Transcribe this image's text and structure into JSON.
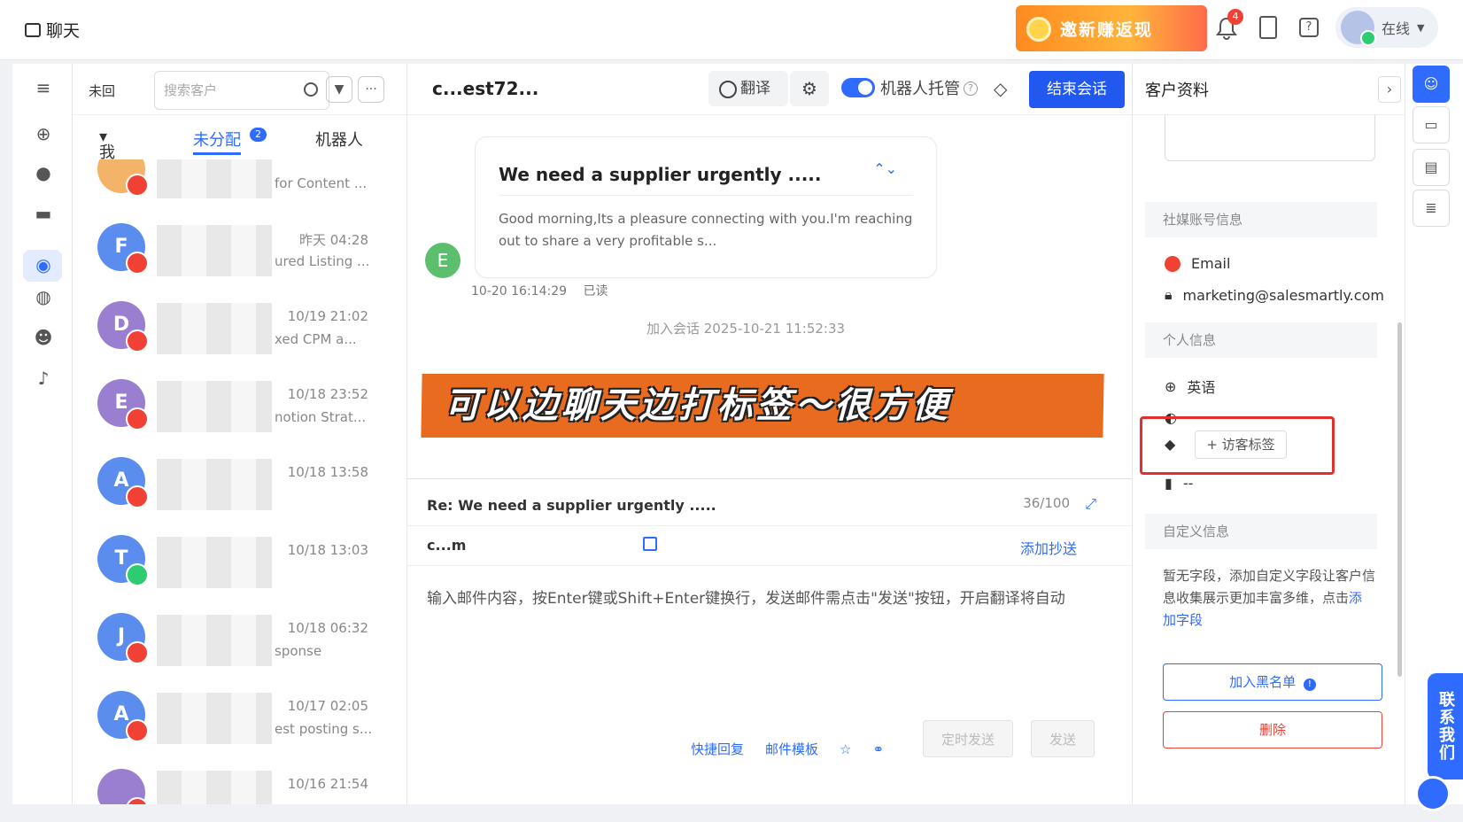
{
  "topbar": {
    "app_title": "聊天",
    "promo_text": "邀新赚返现",
    "notification_count": "4",
    "status_label": "在线"
  },
  "conv_list": {
    "unread_label": "未回",
    "search_placeholder": "搜索客户",
    "tabs": [
      {
        "label": "我"
      },
      {
        "label": "未分配",
        "badge": "2"
      },
      {
        "label": "机器人"
      }
    ],
    "items": [
      {
        "initial": "",
        "time": "",
        "snippet": "for Content ...",
        "color": "#f3b46a",
        "channel": "email"
      },
      {
        "initial": "F",
        "time": "昨天 04:28",
        "snippet": "ured Listing ...",
        "color": "#5b8def",
        "channel": "email"
      },
      {
        "initial": "D",
        "time": "10/19 21:02",
        "snippet": "xed CPM a...",
        "color": "#9a7fd1",
        "channel": "email"
      },
      {
        "initial": "E",
        "time": "10/18 23:52",
        "snippet": "notion Strat...",
        "color": "#9a7fd1",
        "channel": "email"
      },
      {
        "initial": "A",
        "time": "10/18 13:58",
        "snippet": "",
        "color": "#5b8def",
        "channel": "email"
      },
      {
        "initial": "T",
        "time": "10/18 13:03",
        "snippet": "",
        "color": "#5b8def",
        "channel": "whatsapp"
      },
      {
        "initial": "J",
        "time": "10/18 06:32",
        "snippet": "sponse",
        "color": "#5b8def",
        "channel": "email"
      },
      {
        "initial": "A",
        "time": "10/17 02:05",
        "snippet": "est posting s...",
        "color": "#5b8def",
        "channel": "email"
      },
      {
        "initial": "",
        "time": "10/16 21:54",
        "snippet": "",
        "color": "#9a7fd1",
        "channel": "email"
      }
    ]
  },
  "chat": {
    "title": "c...est72...",
    "translate_label": "翻译",
    "robot_label": "机器人托管",
    "end_button": "结束会话",
    "message": {
      "subject": "We need a supplier urgently .....",
      "body": "Good morning,Its a pleasure connecting with you.I'm reaching out to share a very profitable s...",
      "sender_initial": "E",
      "timestamp": "10-20 16:14:29",
      "read_status": "已读"
    },
    "join_notice": "加入会话 2025-10-21 11:52:33",
    "banner_text": "可以边聊天边打标签～很方便",
    "compose": {
      "re_subject": "Re:  We need a supplier urgently .....",
      "char_count": "36/100",
      "to_address": "c...m",
      "cc_label": "添加抄送",
      "placeholder": "输入邮件内容，按Enter键或Shift+Enter键换行，发送邮件需点击\"发送\"按钮，开启翻译将自动",
      "quick_reply": "快捷回复",
      "template": "邮件模板",
      "schedule_send": "定时发送",
      "send": "发送"
    }
  },
  "profile": {
    "title": "客户资料",
    "social_header": "社媒账号信息",
    "email_label": "Email",
    "email_value": "marketing@salesmartly.com",
    "personal_header": "个人信息",
    "language": "英语",
    "region": "-",
    "visitor_tag_button": "+ 访客标签",
    "bookmark_value": "--",
    "custom_header": "自定义信息",
    "custom_empty": "暂无字段，添加自定义字段让客户信息收集展示更加丰富多维，点击",
    "add_field_link": "添加字段",
    "blacklist_button": "加入黑名单",
    "delete_button": "删除"
  },
  "contact_us": "联系我们"
}
